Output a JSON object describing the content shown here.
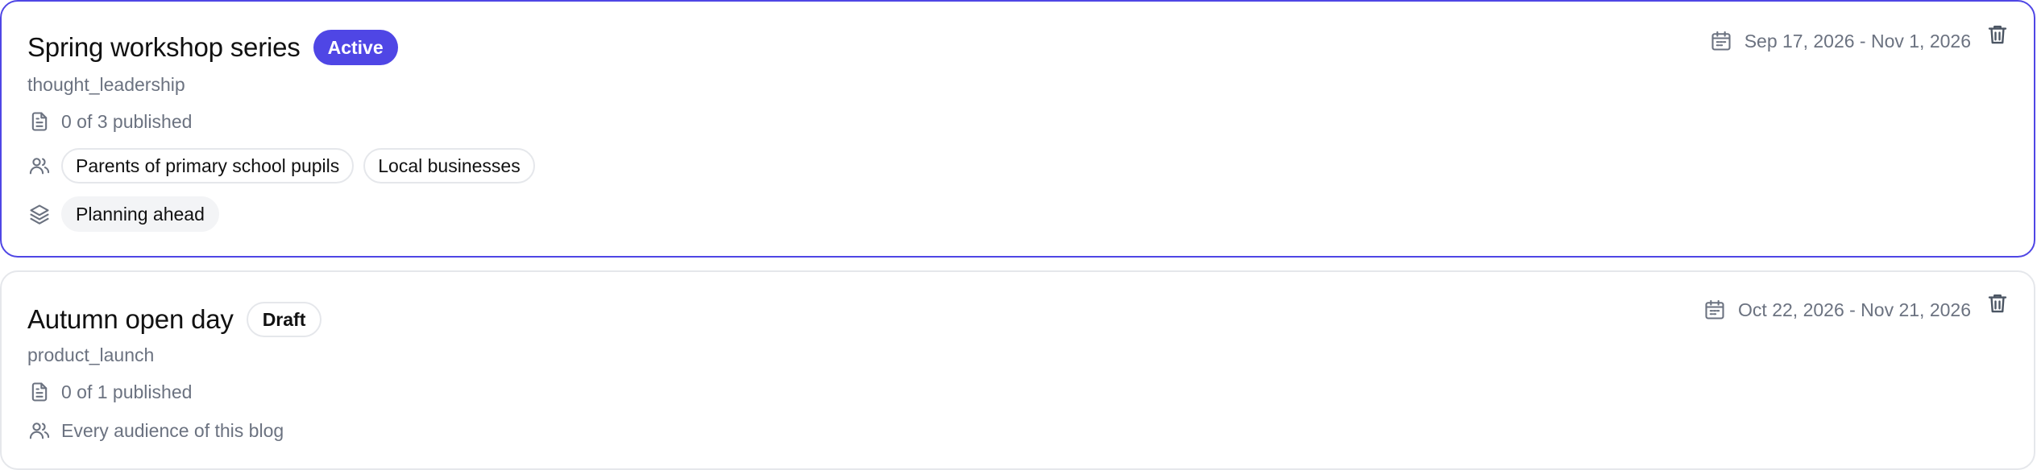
{
  "campaigns": [
    {
      "title": "Spring workshop series",
      "status": "Active",
      "type": "thought_leadership",
      "published": "0 of 3 published",
      "audiences": [
        "Parents of primary school pupils",
        "Local businesses"
      ],
      "topics": [
        "Planning ahead"
      ],
      "date_range": "Sep 17, 2026 - Nov 1, 2026"
    },
    {
      "title": "Autumn open day",
      "status": "Draft",
      "type": "product_launch",
      "published": "0 of 1 published",
      "audience_text": "Every audience of this blog",
      "date_range": "Oct 22, 2026 - Nov 21, 2026"
    }
  ],
  "colors": {
    "accent": "#4f46e5",
    "muted_text": "#6b7280",
    "border": "#e5e7eb",
    "chip_fill": "#f3f4f6"
  },
  "icons": {
    "date": "calendar-icon",
    "delete": "trash-icon",
    "published": "document-icon",
    "audience": "users-icon",
    "topics": "layers-icon"
  }
}
